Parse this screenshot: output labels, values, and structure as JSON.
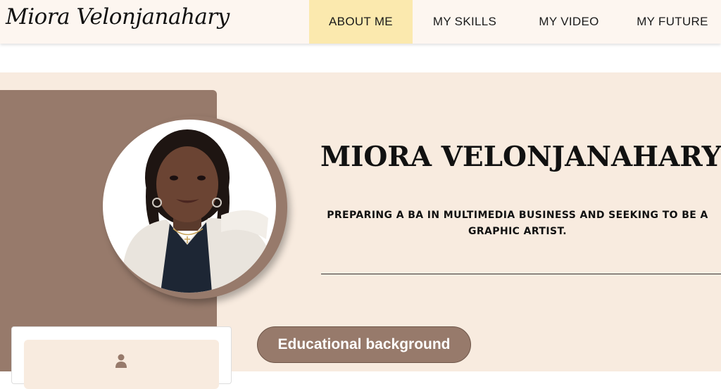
{
  "header": {
    "logo_text": "Miora Velonjanahary",
    "nav": [
      {
        "label": "ABOUT ME",
        "active": true
      },
      {
        "label": "MY SKILLS",
        "active": false
      },
      {
        "label": "MY VIDEO",
        "active": false
      },
      {
        "label": "MY FUTURE",
        "active": false
      }
    ]
  },
  "hero": {
    "name": "MIORA VELONJANAHARY",
    "tagline": "PREPARING A BA IN MULTIMEDIA BUSINESS AND SEEKING TO BE A GRAPHIC ARTIST.",
    "education_button": "Educational background"
  },
  "profile_card": {
    "icon": "user-icon"
  },
  "colors": {
    "nav_background": "#fdf6f0",
    "nav_active": "#fbe9ae",
    "band_background": "#f8ebdf",
    "accent_brown": "#977a6b"
  }
}
